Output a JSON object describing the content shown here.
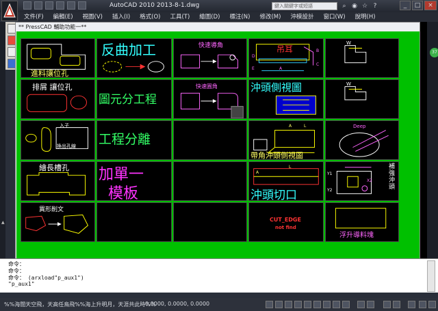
{
  "window": {
    "title": "AutoCAD 2010    2013-8-1.dwg",
    "search_placeholder": "鍵入關鍵字或短語"
  },
  "menu": [
    "文件(F)",
    "編輯(E)",
    "視圖(V)",
    "插入(I)",
    "格式(O)",
    "工具(T)",
    "繪圖(D)",
    "標注(N)",
    "修改(M)",
    "沖模設計",
    "窗口(W)",
    "說明(H)"
  ],
  "dialog": {
    "title": "** PressCAD   輔助功能一**"
  },
  "cells": {
    "c1": "進料讓位孔",
    "c2": "反曲加工",
    "c3": "快速導角",
    "c4": "吊耳",
    "c4_dims": [
      "A",
      "B",
      "C",
      "D",
      "E"
    ],
    "c5": "W",
    "c6": "排屑  讓位孔",
    "c7": "圖元分工程",
    "c8": "快速圓角",
    "c9": "沖頭側視圖",
    "c10": "W",
    "c11_in": "入子",
    "c11": "換出孔線",
    "c12": "工程分離",
    "c14": "帶角沖頭側視圖",
    "c14_dims": [
      "A",
      "L"
    ],
    "c15": "Deep",
    "c16": "繪長槽孔",
    "c17_a": "加單一",
    "c17_b": "模板",
    "c19_dims": [
      "A",
      "L"
    ],
    "c19": "沖頭切口",
    "c20_dims": [
      "Y1",
      "Y2",
      "X2"
    ],
    "c20": "補強沖頭",
    "c21": "異形削文",
    "c24_a": "CUT_EDGE",
    "c24_b": "not find",
    "c25": "浮升導料塊"
  },
  "command": {
    "lines": [
      "命令：",
      "命令：",
      "命令： (arxload\"p_aux1\")",
      "\"p_aux1\""
    ]
  },
  "status": {
    "marquee": "%%海闊天空飛，天高任鳥飛%%海上升明月，天涯共此時%%",
    "coords": "0.0000,    0.0000,    0.0000"
  }
}
